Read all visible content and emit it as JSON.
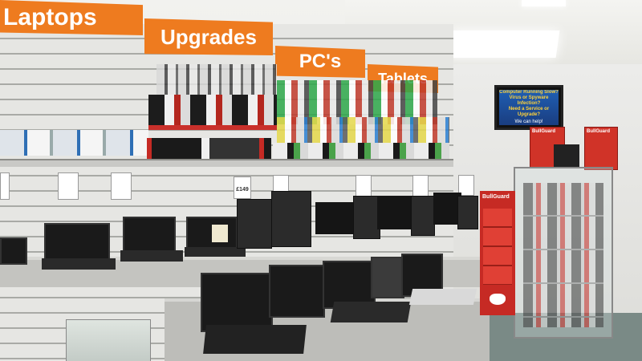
{
  "signage": {
    "laptops": "Laptops",
    "upgrades": "Upgrades",
    "pcs": "PC's",
    "tablets": "Tablets"
  },
  "screen": {
    "line1": "Computer Running Slow?",
    "line2": "Virus or Spyware Infection?",
    "line3": "Need a Service or Upgrade?",
    "line4": "We can help!"
  },
  "brand": {
    "bullguard": "BullGuard"
  },
  "price_tags": {
    "tower": "£149"
  },
  "colors": {
    "banner_orange": "#ee7b1f",
    "bullguard_red": "#c62a24"
  }
}
